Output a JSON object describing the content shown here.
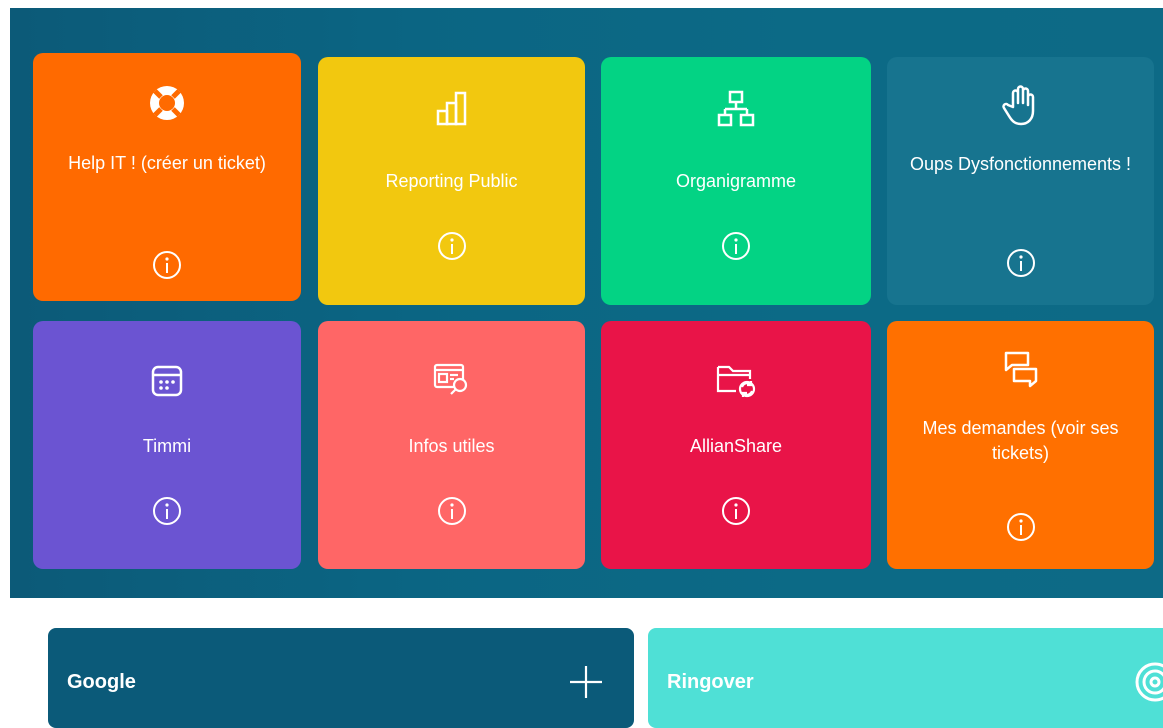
{
  "tiles": [
    {
      "label": "Help IT ! (créer un ticket)",
      "icon": "lifebuoy-icon",
      "color": "#ff6a00"
    },
    {
      "label": "Reporting Public",
      "icon": "bar-chart-icon",
      "color": "#f2c80f"
    },
    {
      "label": "Organigramme",
      "icon": "org-chart-icon",
      "color": "#03d384"
    },
    {
      "label": "Oups Dysfonctionnements !",
      "icon": "hand-icon",
      "color": "#17748f"
    },
    {
      "label": "Timmi",
      "icon": "calendar-icon",
      "color": "#6b54d2"
    },
    {
      "label": "Infos utiles",
      "icon": "web-search-icon",
      "color": "#ff6666"
    },
    {
      "label": "AllianShare",
      "icon": "folder-sync-icon",
      "color": "#e91448"
    },
    {
      "label": "Mes demandes (voir ses tickets)",
      "icon": "chat-bubbles-icon",
      "color": "#ff7000"
    }
  ],
  "cards": [
    {
      "title": "Google",
      "action_icon": "plus-icon",
      "color": "#0b5a79"
    },
    {
      "title": "Ringover",
      "action_icon": "signal-icon",
      "color": "#4fe0d6"
    }
  ]
}
